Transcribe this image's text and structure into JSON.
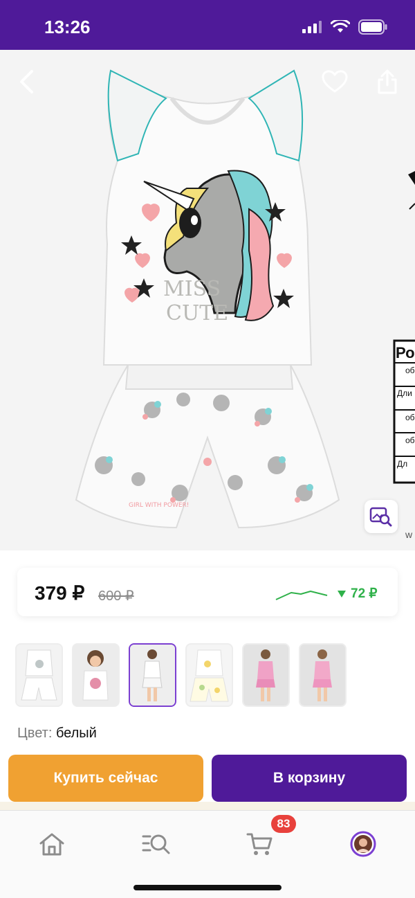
{
  "status_bar": {
    "time": "13:26"
  },
  "gallery": {
    "print_text_1": "MISS",
    "print_text_2": "CUTE",
    "print_text_small": "GIRL WITH POWER!",
    "table_header": "Ро",
    "table_rows": [
      "об",
      "Дли",
      "об",
      "об",
      "Дл"
    ],
    "edge_text": "w"
  },
  "price": {
    "current": "379 ₽",
    "old": "600 ₽",
    "drop": "72 ₽",
    "trend_color": "#2fb14a"
  },
  "thumbnails": [
    {
      "name": "shirt-shorts-white",
      "selected": false
    },
    {
      "name": "girl-doll-shirt",
      "selected": false
    },
    {
      "name": "girl-unicorn-set",
      "selected": true
    },
    {
      "name": "shirt-shorts-floral",
      "selected": false
    },
    {
      "name": "girl-pink-set-1",
      "selected": false
    },
    {
      "name": "girl-pink-set-2",
      "selected": false
    }
  ],
  "color": {
    "label": "Цвет:",
    "value": "белый"
  },
  "actions": {
    "buy_now": "Купить сейчас",
    "add_to_cart": "В корзину"
  },
  "tabbar": {
    "cart_count": "83",
    "icons": [
      "home-icon",
      "catalog-search-icon",
      "cart-icon",
      "profile-avatar"
    ]
  },
  "colors": {
    "brand": "#4f1a99",
    "buy": "#f0a132",
    "badge": "#e8413c"
  }
}
